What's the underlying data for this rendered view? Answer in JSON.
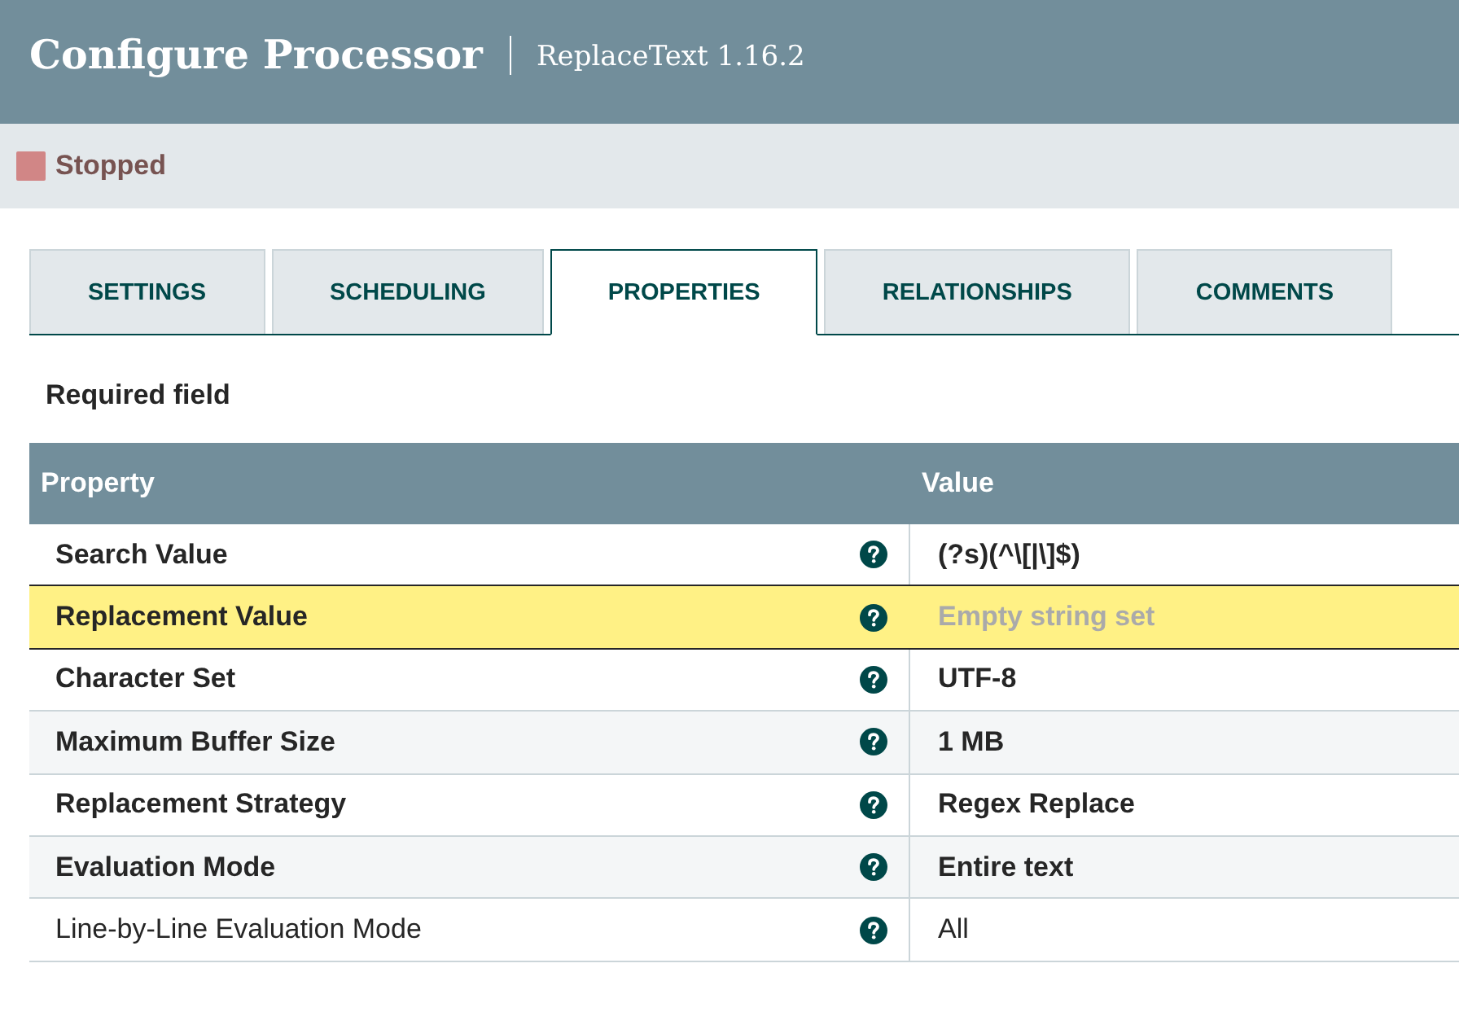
{
  "dialog": {
    "title": "Configure Processor",
    "subtitle": "ReplaceText 1.16.2"
  },
  "status": {
    "kind": "stopped",
    "label": "Stopped"
  },
  "tabs": [
    {
      "label": "SETTINGS",
      "selected": false
    },
    {
      "label": "SCHEDULING",
      "selected": false
    },
    {
      "label": "PROPERTIES",
      "selected": true
    },
    {
      "label": "RELATIONSHIPS",
      "selected": false
    },
    {
      "label": "COMMENTS",
      "selected": false
    }
  ],
  "note": "Required field",
  "table": {
    "columns": [
      "Property",
      "Value"
    ],
    "rows": [
      {
        "property": "Search Value",
        "value": "(?s)(^\\[|\\]$)",
        "required": true,
        "selected": false,
        "empty": false
      },
      {
        "property": "Replacement Value",
        "value": "Empty string set",
        "required": true,
        "selected": true,
        "empty": true
      },
      {
        "property": "Character Set",
        "value": "UTF-8",
        "required": true,
        "selected": false,
        "empty": false
      },
      {
        "property": "Maximum Buffer Size",
        "value": "1 MB",
        "required": true,
        "selected": false,
        "empty": false
      },
      {
        "property": "Replacement Strategy",
        "value": "Regex Replace",
        "required": true,
        "selected": false,
        "empty": false
      },
      {
        "property": "Evaluation Mode",
        "value": "Entire text",
        "required": true,
        "selected": false,
        "empty": false
      },
      {
        "property": "Line-by-Line Evaluation Mode",
        "value": "All",
        "required": false,
        "selected": false,
        "empty": false
      }
    ]
  }
}
